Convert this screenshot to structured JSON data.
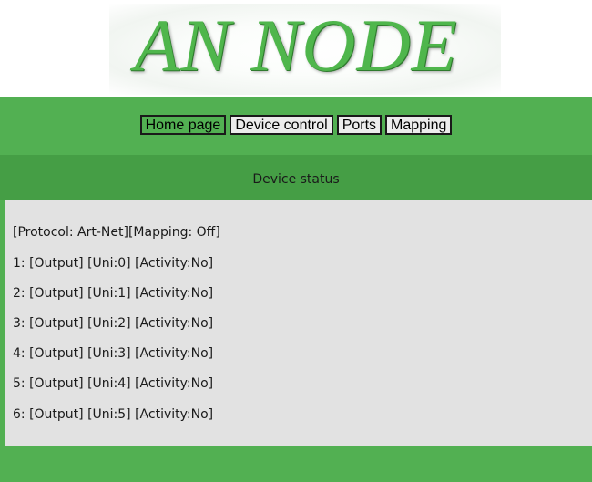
{
  "logo": {
    "title": "AN NODE"
  },
  "nav": {
    "items": [
      {
        "label": "Home page"
      },
      {
        "label": "Device control"
      },
      {
        "label": "Ports"
      },
      {
        "label": "Mapping"
      }
    ]
  },
  "section": {
    "title": "Device status"
  },
  "status": {
    "summary": "[Protocol: Art-Net][Mapping: Off]",
    "ports": [
      "1: [Output] [Uni:0] [Activity:No]",
      "2: [Output] [Uni:1] [Activity:No]",
      "3: [Output] [Uni:2] [Activity:No]",
      "4: [Output] [Uni:3] [Activity:No]",
      "5: [Output] [Uni:4] [Activity:No]",
      "6: [Output] [Uni:5] [Activity:No]"
    ]
  },
  "colors": {
    "brand_green": "#52b052",
    "header_green": "#459e45",
    "logo_green": "#4fb64c",
    "panel_gray": "#e2e2e2"
  }
}
